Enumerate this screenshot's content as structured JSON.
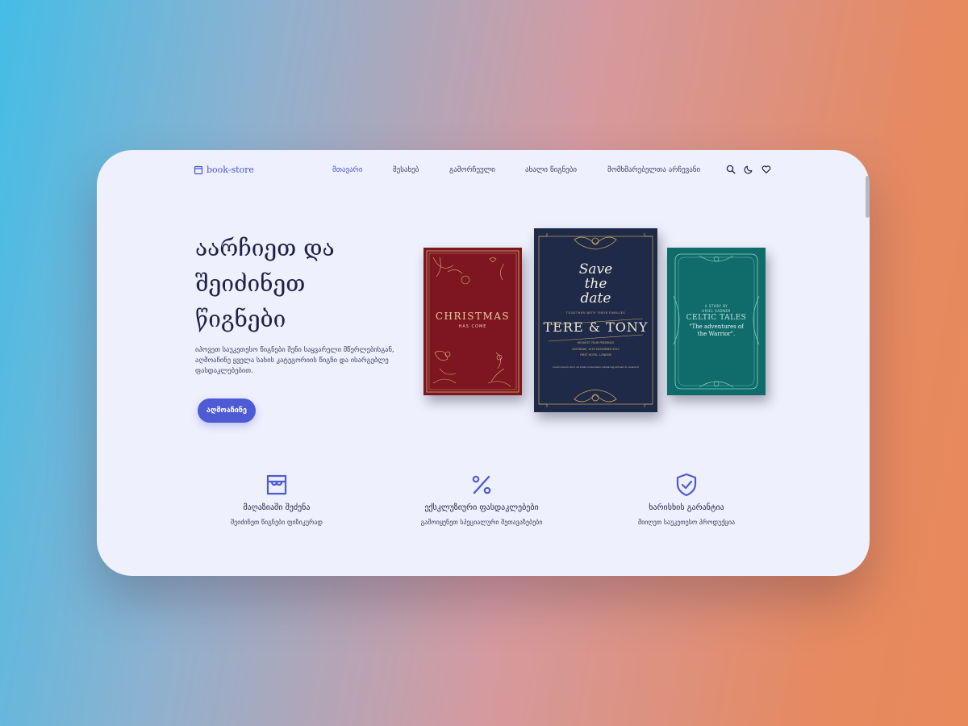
{
  "header": {
    "logo_text": "book-store",
    "nav": [
      {
        "label": "მთავარი",
        "active": true
      },
      {
        "label": "შესახებ"
      },
      {
        "label": "გამორჩეული"
      },
      {
        "label": "ახალი წიგნები"
      },
      {
        "label": "მომხმარებელთა არჩევანი"
      }
    ],
    "icons": [
      "search-icon",
      "moon-icon",
      "heart-icon"
    ]
  },
  "hero": {
    "title_lines": [
      "აარჩიეთ და",
      "შეიძინეთ",
      "წიგნები"
    ],
    "description": "იპოვეთ საუკეთესო წიგნები შენი საყვარელი მწერლებისგან, აღმოაჩინე ყველა სახის კატეგორიის წიგნი და ისარგებლე ფასდაკლებებით.",
    "cta_label": "აღმოაჩინე"
  },
  "books": {
    "red": {
      "title": "CHRISTMAS",
      "subtitle": "HAS COME"
    },
    "navy": {
      "script_lines": [
        "Save",
        "the",
        "date"
      ],
      "line1": "TOGETHER WITH THEIR FAMILIES",
      "names": "TERE & TONY",
      "line2": "REQUEST YOUR PRESENCE",
      "line3": "SATURDAY, 12TH DECEMBER 2021",
      "line4": "FIRST HOTEL, LONDON",
      "line5": "Lorem ipsum dolor sit amet consectetur adipiscing elit sed do eiusmod"
    },
    "teal": {
      "small": "A STORY BY",
      "author": "URIEL SADNER",
      "title": "CELTIC TALES",
      "subtitle_lines": [
        "\"The adventures of",
        "the Warrior\"."
      ]
    }
  },
  "features": [
    {
      "icon": "store-icon",
      "title": "მაღაზიაში შეძენა",
      "desc": "შეიძინეთ წიგნები ფიზიკურად"
    },
    {
      "icon": "percent-icon",
      "title": "ექსკლუზიური ფასდაკლებები",
      "desc": "გამოიყენეთ სპეციალური შეთავაზებები"
    },
    {
      "icon": "shield-check-icon",
      "title": "ხარისხის გარანტია",
      "desc": "მიიღეთ საუკეთესო პროდუქცია"
    }
  ],
  "colors": {
    "accent": "#4f5bd5",
    "card_background": "#eef0fd",
    "heading": "#1f2246"
  }
}
